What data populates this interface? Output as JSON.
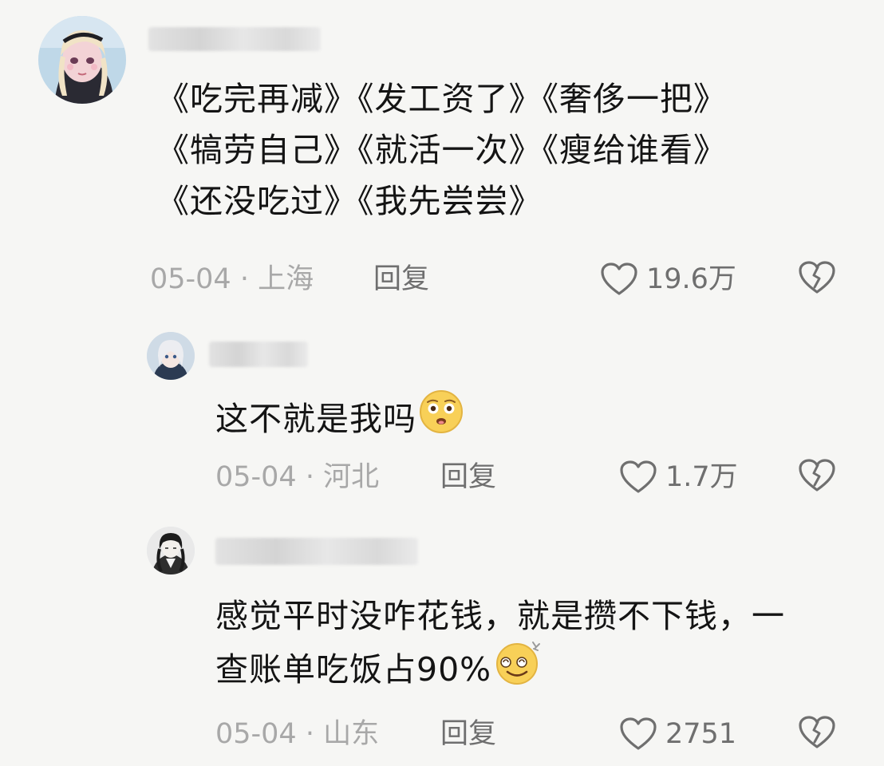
{
  "comments": [
    {
      "lines": [
        "《吃完再减》《发工资了》《奢侈一把》",
        "《犒劳自己》《就活一次》《瘦给谁看》",
        "《还没吃过》《我先尝尝》"
      ],
      "date_location": "05-04 · 上海",
      "reply_label": "回复",
      "likes": "19.6万"
    },
    {
      "lines": [
        "这不就是我吗"
      ],
      "emoji": "pleading-face-emoji",
      "date_location": "05-04 · 河北",
      "reply_label": "回复",
      "likes": "1.7万"
    },
    {
      "lines": [
        "感觉平时没咋花钱，就是攒不下钱，一",
        "查账单吃饭占90%"
      ],
      "emoji": "dizzy-smile-emoji",
      "date_location": "05-04 · 山东",
      "reply_label": "回复",
      "likes": "2751"
    }
  ],
  "colors": {
    "background": "#f6f6f4",
    "text": "#141414",
    "meta_text": "#a8a8a8",
    "action_text": "#6f6f6f"
  },
  "icons": [
    "heart-outline-icon",
    "broken-heart-icon"
  ]
}
